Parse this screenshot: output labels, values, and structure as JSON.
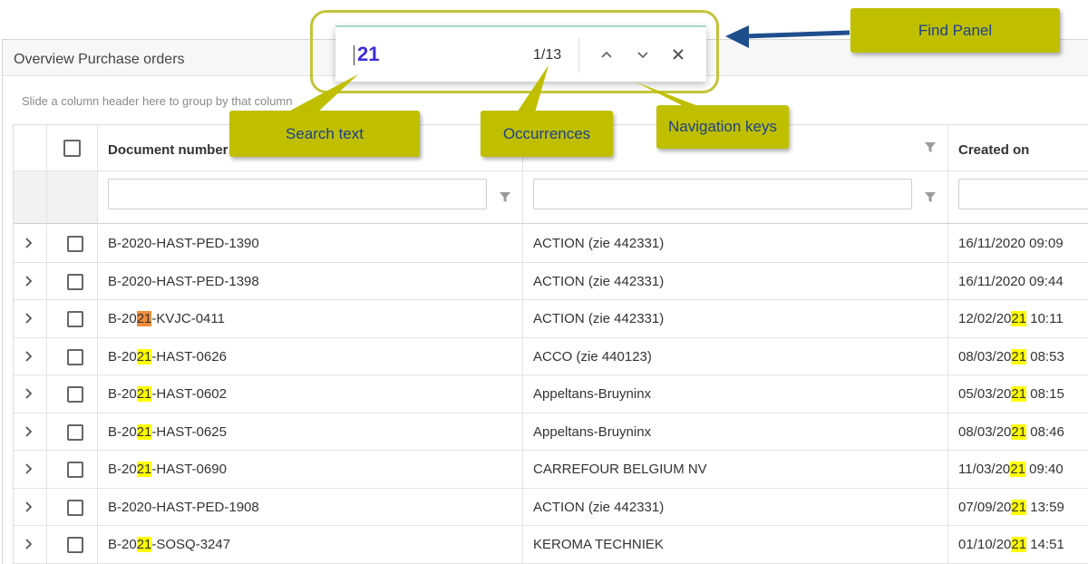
{
  "panel": {
    "title": "Overview Purchase orders",
    "group_hint": "Slide a column header here to group by that column"
  },
  "grid": {
    "columns": [
      {
        "label": "Document number"
      },
      {
        "label": ""
      },
      {
        "label": "Created on"
      }
    ],
    "rows": [
      {
        "doc_parts": [
          "B-2020-HAST-PED-1390"
        ],
        "doc_marks": [],
        "supplier": "ACTION (zie 442331)",
        "created_parts": [
          "16/11/2020 09:09"
        ],
        "created_marks": []
      },
      {
        "doc_parts": [
          "B-2020-HAST-PED-1398"
        ],
        "doc_marks": [],
        "supplier": "ACTION (zie 442331)",
        "created_parts": [
          "16/11/2020 09:44"
        ],
        "created_marks": []
      },
      {
        "doc_parts": [
          "B-20",
          "21",
          "-KVJC-0411"
        ],
        "doc_marks": [
          "",
          "cur",
          ""
        ],
        "supplier": "ACTION (zie 442331)",
        "created_parts": [
          "12/02/20",
          "21",
          " 10:11"
        ],
        "created_marks": [
          "",
          "hl",
          ""
        ]
      },
      {
        "doc_parts": [
          "B-20",
          "21",
          "-HAST-0626"
        ],
        "doc_marks": [
          "",
          "hl",
          ""
        ],
        "supplier": "ACCO (zie 440123)",
        "created_parts": [
          "08/03/20",
          "21",
          " 08:53"
        ],
        "created_marks": [
          "",
          "hl",
          ""
        ]
      },
      {
        "doc_parts": [
          "B-20",
          "21",
          "-HAST-0602"
        ],
        "doc_marks": [
          "",
          "hl",
          ""
        ],
        "supplier": "Appeltans-Bruyninx",
        "created_parts": [
          "05/03/20",
          "21",
          " 08:15"
        ],
        "created_marks": [
          "",
          "hl",
          ""
        ]
      },
      {
        "doc_parts": [
          "B-20",
          "21",
          "-HAST-0625"
        ],
        "doc_marks": [
          "",
          "hl",
          ""
        ],
        "supplier": "Appeltans-Bruyninx",
        "created_parts": [
          "08/03/20",
          "21",
          " 08:46"
        ],
        "created_marks": [
          "",
          "hl",
          ""
        ]
      },
      {
        "doc_parts": [
          "B-20",
          "21",
          "-HAST-0690"
        ],
        "doc_marks": [
          "",
          "hl",
          ""
        ],
        "supplier": "CARREFOUR BELGIUM NV",
        "created_parts": [
          "11/03/20",
          "21",
          " 09:40"
        ],
        "created_marks": [
          "",
          "hl",
          ""
        ]
      },
      {
        "doc_parts": [
          "B-2020-HAST-PED-1908"
        ],
        "doc_marks": [],
        "supplier": "ACTION (zie 442331)",
        "created_parts": [
          "07/09/20",
          "21",
          " 13:59"
        ],
        "created_marks": [
          "",
          "hl",
          ""
        ]
      },
      {
        "doc_parts": [
          "B-20",
          "21",
          "-SOSQ-3247"
        ],
        "doc_marks": [
          "",
          "hl",
          ""
        ],
        "supplier": "KEROMA TECHNIEK",
        "created_parts": [
          "01/10/20",
          "21",
          " 14:51"
        ],
        "created_marks": [
          "",
          "hl",
          ""
        ]
      }
    ]
  },
  "find_panel": {
    "search_text": "21",
    "occurrences": "1/13",
    "icons": [
      "chevron-up-icon",
      "chevron-down-icon",
      "close-icon"
    ]
  },
  "callouts": {
    "find_panel": "Find Panel",
    "search_text": "Search text",
    "occurrences": "Occurrences",
    "navigation_keys": "Navigation keys"
  },
  "colors": {
    "callout_bg": "#bfbf00",
    "callout_text": "#1e3f8c",
    "highlight": "#ffff00",
    "current_highlight": "#f28c3a",
    "arrow": "#1f4e8c",
    "outline": "#c2c43a"
  }
}
